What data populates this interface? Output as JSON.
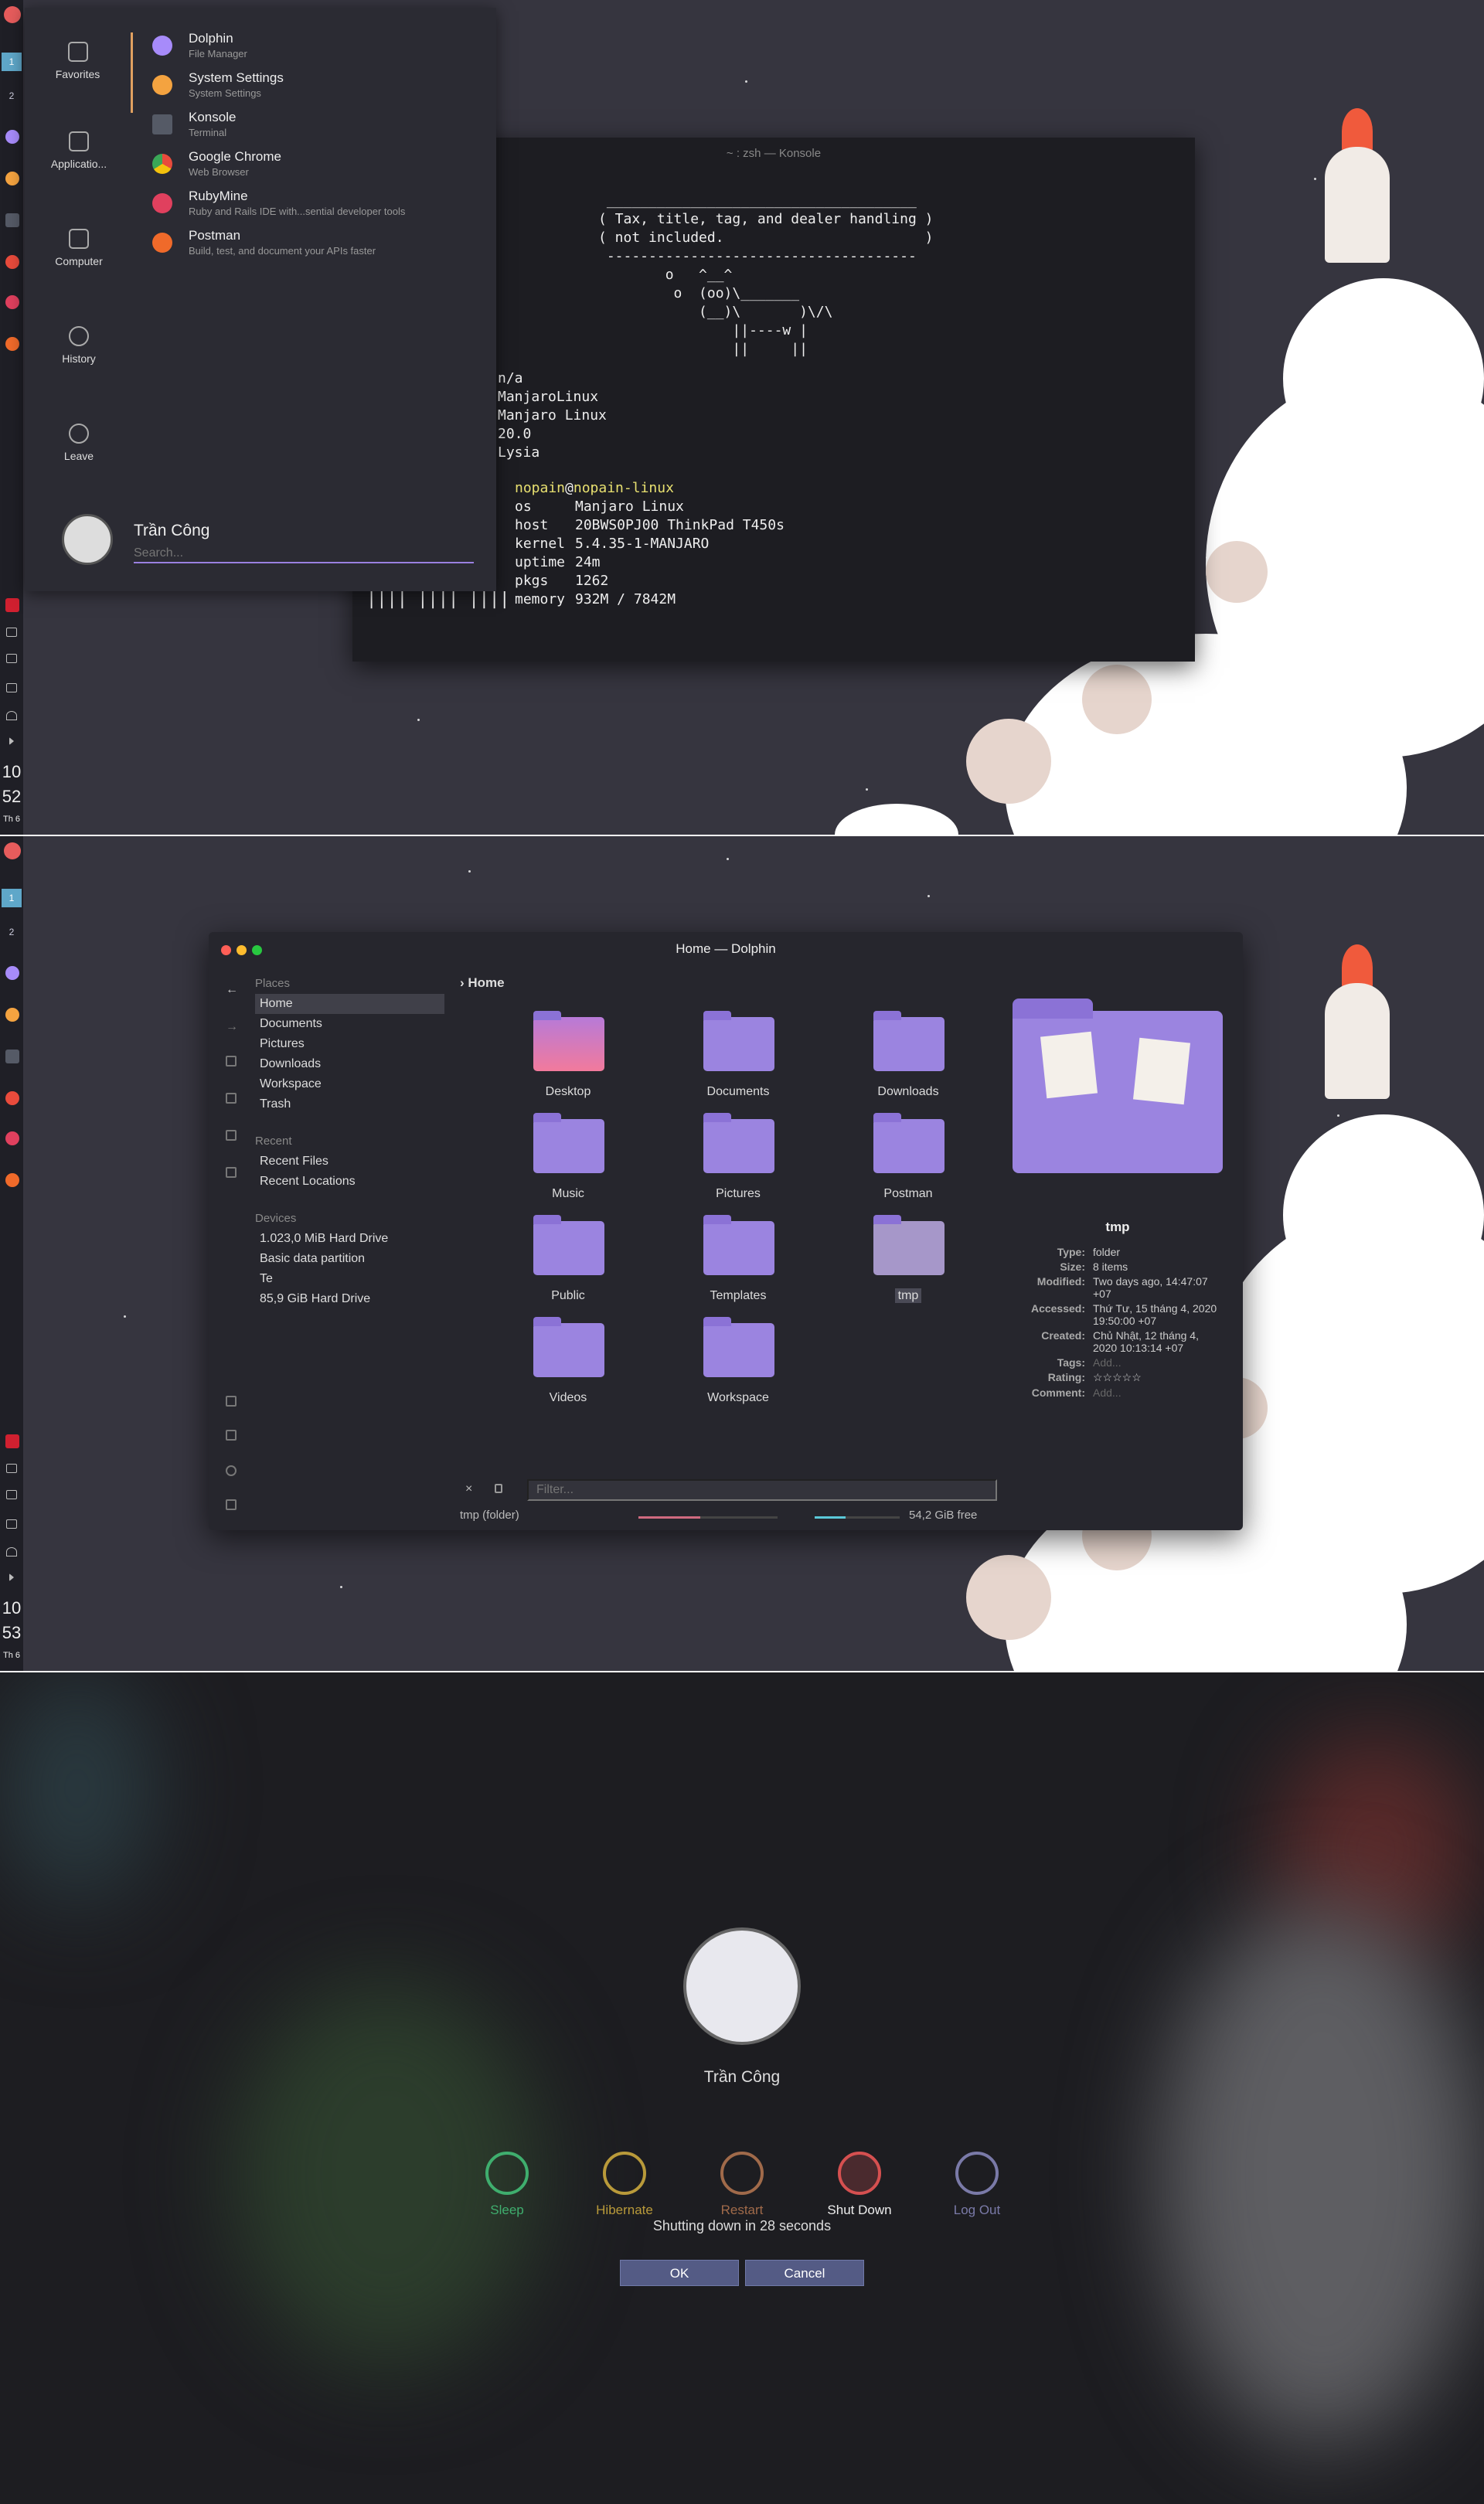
{
  "launcher": {
    "nav": [
      "Favorites",
      "Applicatio...",
      "Computer",
      "History",
      "Leave"
    ],
    "apps": [
      {
        "name": "Dolphin",
        "desc": "File Manager",
        "color": "#a78bfa"
      },
      {
        "name": "System Settings",
        "desc": "System Settings",
        "color": "#f4a340"
      },
      {
        "name": "Konsole",
        "desc": "Terminal",
        "color": "#555a66"
      },
      {
        "name": "Google Chrome",
        "desc": "Web Browser",
        "color": "#e94b3c"
      },
      {
        "name": "RubyMine",
        "desc": "Ruby and Rails IDE with...sential developer tools",
        "color": "#e0405e"
      },
      {
        "name": "Postman",
        "desc": "Build, test, and document your APIs faster",
        "color": "#f06a2a"
      }
    ],
    "user": "Trần Công",
    "search_placeholder": "Search..."
  },
  "dock1": {
    "ws1": "1",
    "ws2": "2",
    "hour": "10",
    "min": "52",
    "day": "Th 6"
  },
  "dock2": {
    "ws1": "1",
    "ws2": "2",
    "hour": "10",
    "min": "53",
    "day": "Th 6"
  },
  "konsole": {
    "title": "~ : zsh — Konsole",
    "cow": " _____________________________________\n( Tax, title, tag, and dealer handling )\n( not included.                        )\n -------------------------------------\n        o   ^__^\n         o  (oo)\\_______\n            (__)\\       )\\/\\\n                ||----w |\n                ||     ||",
    "left": "n/a\nManjaroLinux\nManjaro Linux\n20.0\nLysia",
    "user": "nopain",
    "at": "@",
    "host": "nopain-linux",
    "keys": "os\nhost\nkernel\nuptime\npkgs\nmemory",
    "vals": "Manjaro Linux\n20BWS0PJ00 ThinkPad T450s\n5.4.35-1-MANJARO\n24m\n1262\n932M / 7842M",
    "bars": "|||| |||| ||||"
  },
  "dolphin": {
    "title": "Home — Dolphin",
    "crumb": "Home",
    "places_header": "Places",
    "places": [
      "Home",
      "Documents",
      "Pictures",
      "Downloads",
      "Workspace",
      "Trash"
    ],
    "recent_header": "Recent",
    "recent": [
      "Recent Files",
      "Recent Locations"
    ],
    "devices_header": "Devices",
    "devices": [
      "1.023,0 MiB Hard Drive",
      "Basic data partition",
      "Te",
      "85,9 GiB Hard Drive"
    ],
    "folders": [
      "Desktop",
      "Documents",
      "Downloads",
      "Music",
      "Pictures",
      "Postman",
      "Public",
      "Templates",
      "tmp",
      "Videos",
      "Workspace"
    ],
    "info": {
      "name": "tmp",
      "rows": [
        [
          "Type:",
          "folder"
        ],
        [
          "Size:",
          "8 items"
        ],
        [
          "Modified:",
          "Two days ago, 14:47:07 +07"
        ],
        [
          "Accessed:",
          "Thứ Tư, 15 tháng 4, 2020 19:50:00 +07"
        ],
        [
          "Created:",
          "Chủ Nhật, 12 tháng 4, 2020 10:13:14 +07"
        ]
      ],
      "tags_label": "Tags:",
      "tags_val": "Add...",
      "rating_label": "Rating:",
      "rating_val": "☆☆☆☆☆",
      "comment_label": "Comment:",
      "comment_val": "Add..."
    },
    "filter_placeholder": "Filter...",
    "status": "tmp (folder)",
    "free": "54,2 GiB free"
  },
  "logout": {
    "user": "Trần Công",
    "actions": [
      {
        "label": "Sleep",
        "color": "#3fae6e"
      },
      {
        "label": "Hibernate",
        "color": "#b99a3a"
      },
      {
        "label": "Restart",
        "color": "#a06a4a"
      },
      {
        "label": "Shut Down",
        "color": "#d55050"
      },
      {
        "label": "Log Out",
        "color": "#7a7aa8"
      }
    ],
    "message": "Shutting down in 28 seconds",
    "ok": "OK",
    "cancel": "Cancel"
  }
}
